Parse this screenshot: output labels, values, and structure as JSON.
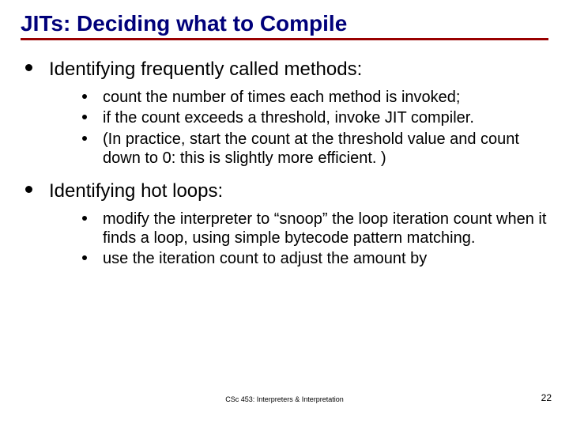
{
  "title": "JITs: Deciding what to Compile",
  "sections": [
    {
      "heading": "Identifying frequently called methods:",
      "items": [
        "count the number of times each method is invoked;",
        "if the count exceeds a threshold, invoke JIT compiler.",
        "(In practice, start the count at the threshold value and count down to 0: this is slightly more efficient. )"
      ]
    },
    {
      "heading": "Identifying hot loops:",
      "items": [
        "modify the interpreter to “snoop” the loop iteration count when it finds a loop, using simple bytecode pattern matching.",
        "use the iteration count to adjust the amount by"
      ]
    }
  ],
  "footer": "CSc 453: Interpreters & Interpretation",
  "page_number": "22"
}
